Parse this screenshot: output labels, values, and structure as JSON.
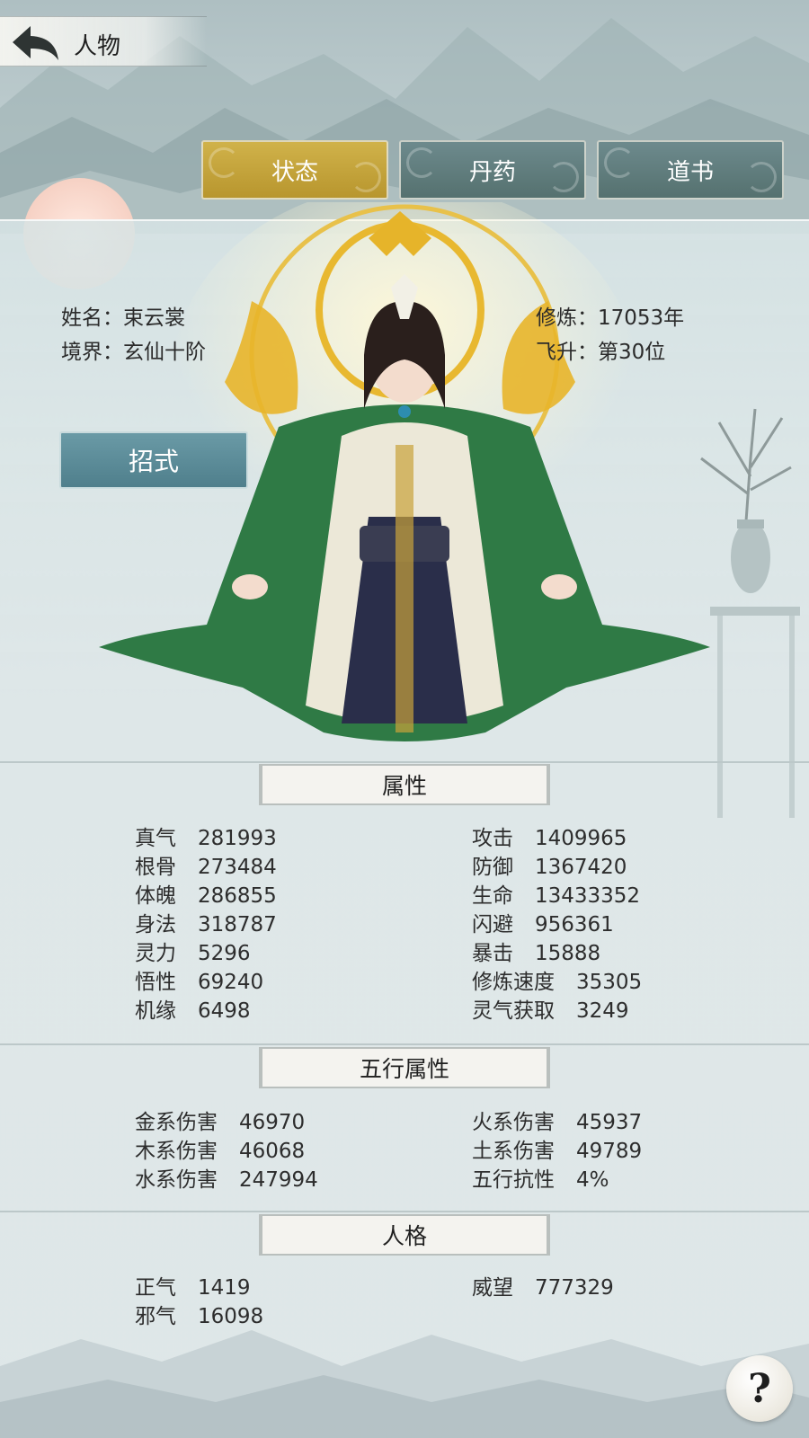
{
  "header": {
    "title": "人物"
  },
  "tabs": [
    {
      "label": "状态",
      "active": true
    },
    {
      "label": "丹药",
      "active": false
    },
    {
      "label": "道书",
      "active": false
    }
  ],
  "profile": {
    "name_label": "姓名：",
    "name_value": "束云裳",
    "realm_label": "境界：",
    "realm_value": "玄仙十阶",
    "cultivation_label": "修炼：",
    "cultivation_value": "17053年",
    "ascension_label": "飞升：",
    "ascension_value": "第30位"
  },
  "skill_button": "招式",
  "attributes": {
    "title": "属性",
    "left": [
      {
        "label": "真气",
        "value": "281993"
      },
      {
        "label": "根骨",
        "value": "273484"
      },
      {
        "label": "体魄",
        "value": "286855"
      },
      {
        "label": "身法",
        "value": "318787"
      },
      {
        "label": "灵力",
        "value": "5296"
      },
      {
        "label": "悟性",
        "value": "69240"
      },
      {
        "label": "机缘",
        "value": "6498"
      }
    ],
    "right": [
      {
        "label": "攻击",
        "value": "1409965"
      },
      {
        "label": "防御",
        "value": "1367420"
      },
      {
        "label": "生命",
        "value": "13433352"
      },
      {
        "label": "闪避",
        "value": "956361"
      },
      {
        "label": "暴击",
        "value": "15888"
      },
      {
        "label": "修炼速度",
        "value": "35305"
      },
      {
        "label": "灵气获取",
        "value": "3249"
      }
    ]
  },
  "elements": {
    "title": "五行属性",
    "left": [
      {
        "label": "金系伤害",
        "value": "46970"
      },
      {
        "label": "木系伤害",
        "value": "46068"
      },
      {
        "label": "水系伤害",
        "value": "247994"
      }
    ],
    "right": [
      {
        "label": "火系伤害",
        "value": "45937"
      },
      {
        "label": "土系伤害",
        "value": "49789"
      },
      {
        "label": "五行抗性",
        "value": "4%"
      }
    ]
  },
  "personality": {
    "title": "人格",
    "left": [
      {
        "label": "正气",
        "value": "1419"
      },
      {
        "label": "邪气",
        "value": "16098"
      }
    ],
    "right": [
      {
        "label": "威望",
        "value": "777329"
      }
    ]
  },
  "help_button": "?"
}
